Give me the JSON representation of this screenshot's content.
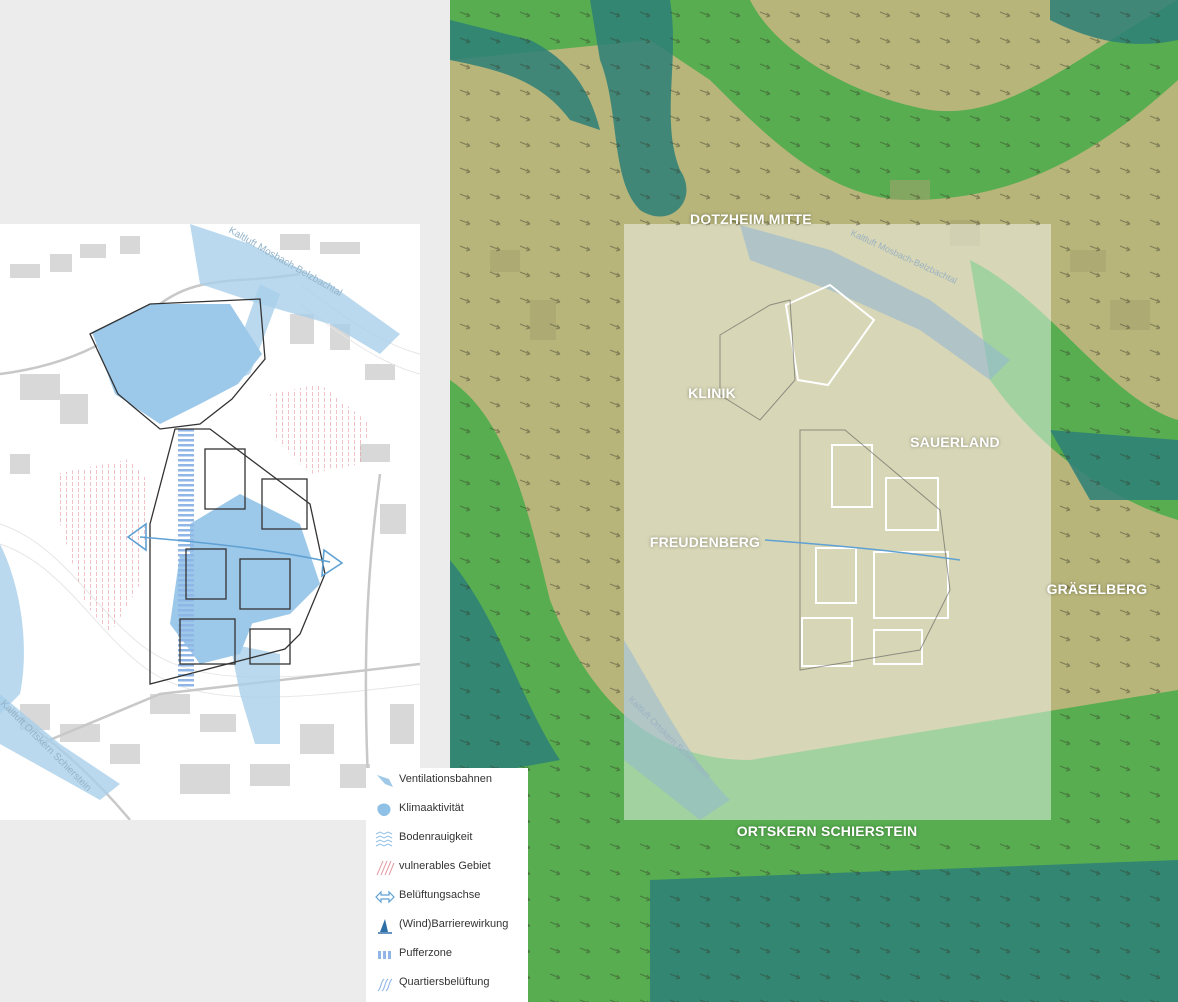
{
  "left_plan": {
    "labels": {
      "kaltluft_top": "Kaltluft Mosbach-Belzbachtal",
      "kaltluft_bottom": "Kaltluft Ortskern Schierstein"
    }
  },
  "right_map": {
    "places": {
      "dotzheim": "DOTZHEIM MITTE",
      "klinik": "KLINIK",
      "sauerland": "SAUERLAND",
      "freudenberg": "FREUDENBERG",
      "graeselberg": "GRÄSELBERG",
      "schierstein": "ORTSKERN SCHIERSTEIN"
    },
    "overlay_labels": {
      "kaltluft_top": "Kaltluft Mosbach-Belzbachtal",
      "kaltluft_bottom": "Kaltluft Ortskern Schierstein"
    }
  },
  "legend": {
    "items": [
      {
        "label": "Ventilationsbahnen",
        "icon": "ventilation-path-icon"
      },
      {
        "label": "Klimaaktivität",
        "icon": "climate-activity-icon"
      },
      {
        "label": "Bodenrauigkeit",
        "icon": "ground-roughness-icon"
      },
      {
        "label": "vulnerables Gebiet",
        "icon": "vulnerable-area-icon"
      },
      {
        "label": "Belüftungsachse",
        "icon": "ventilation-axis-icon"
      },
      {
        "label": "(Wind)Barrierewirkung",
        "icon": "wind-barrier-icon"
      },
      {
        "label": "Pufferzone",
        "icon": "buffer-zone-icon"
      },
      {
        "label": "Quartiersbelüftung",
        "icon": "quarter-ventilation-icon"
      }
    ]
  },
  "colors": {
    "ventilation_blue": "#9fc9e6",
    "vulnerable_red": "#e8a0a8",
    "terrain_green": "#3aa84a",
    "terrain_yellow": "#b6b474",
    "terrain_teal": "#2f7f7a"
  }
}
